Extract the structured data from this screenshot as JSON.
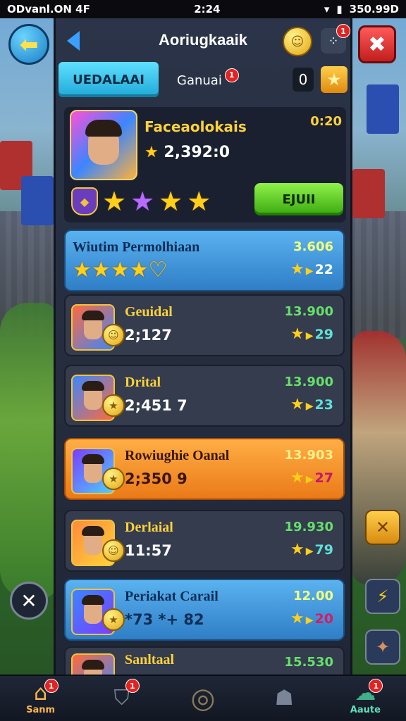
{
  "status_bar": {
    "left": "ODvanl.ON  4F",
    "time": "2:24",
    "right": "350.99D"
  },
  "header": {
    "title": "Aoriugkaaik",
    "notification_count": "1"
  },
  "tabs": [
    {
      "label": "UEDALAAI",
      "active": true
    },
    {
      "label": "Ganuai",
      "active": false,
      "badge": "1"
    }
  ],
  "tab_counter": "0",
  "featured": {
    "name": "Faceaolokais",
    "time": "0:20",
    "score": "2,392:0",
    "join_label": "EJUII"
  },
  "section": {
    "title": "Wiutim Permolhiaan",
    "points": "3.606",
    "rank": "22",
    "stars": 5
  },
  "entries": [
    {
      "name": "Geuidal",
      "score": "2;127",
      "points": "13.900",
      "rank": "29",
      "style": "dark"
    },
    {
      "name": "Drital",
      "score": "2;451     7",
      "points": "13.900",
      "rank": "23",
      "style": "dark"
    },
    {
      "name": "Rowiughie Oanal",
      "score": "2;350 9",
      "points": "13.903",
      "rank": "27",
      "style": "orange"
    },
    {
      "name": "Derlaial",
      "score": "11:57",
      "points": "19.930",
      "rank": "79",
      "style": "dark"
    },
    {
      "name": "Periakat Carail",
      "score": "*73 *+ 82",
      "points": "12.00",
      "rank": "20",
      "style": "blue"
    },
    {
      "name": "Sanltaal",
      "score": "",
      "points": "15.530",
      "rank": "",
      "style": "dark"
    }
  ],
  "nav": [
    {
      "label": "Sanm",
      "icon": "shop-icon",
      "badge": "1"
    },
    {
      "label": "",
      "icon": "shield-icon",
      "badge": "1"
    },
    {
      "label": "",
      "icon": "ring-icon",
      "badge": ""
    },
    {
      "label": "",
      "icon": "robot-icon",
      "badge": ""
    },
    {
      "label": "Aaute",
      "icon": "cloud-icon",
      "badge": "1"
    }
  ],
  "colors": {
    "accent_blue": "#1fa9d8",
    "join_green": "#3aa80f",
    "highlight_orange": "#ea7a18",
    "gold": "#ffcf1a"
  }
}
